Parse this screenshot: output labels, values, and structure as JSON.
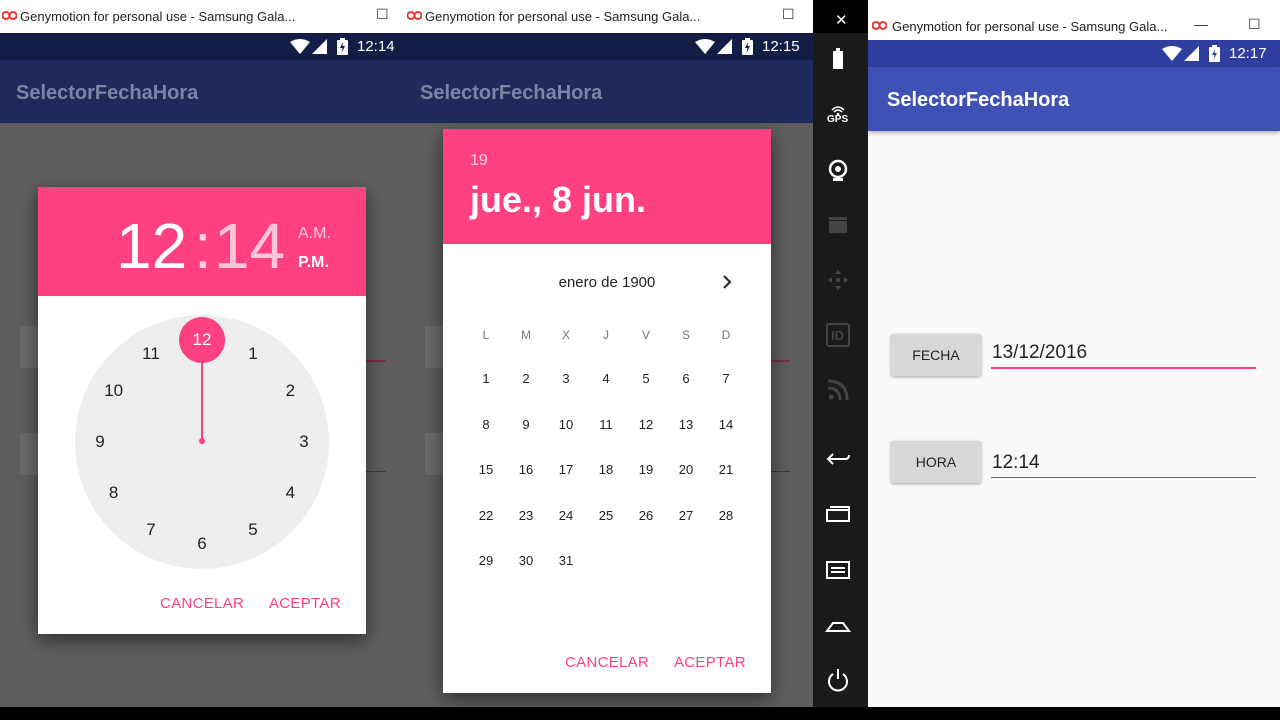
{
  "windows": [
    {
      "title": "Genymotion for personal use - Samsung Gala...",
      "time": "12:14",
      "app_title": "SelectorFechaHora"
    },
    {
      "title": "Genymotion for personal use - Samsung Gala...",
      "time": "12:15",
      "app_title": "SelectorFechaHora"
    },
    {
      "title": "Genymotion for personal use - Samsung Gala...",
      "time": "12:17",
      "app_title": "SelectorFechaHora"
    }
  ],
  "window_controls": {
    "minimize": "—",
    "maximize": "☐",
    "close": "✕"
  },
  "time_picker": {
    "hour": "12",
    "colon": ":",
    "minute": "14",
    "am": "A.M.",
    "pm": "P.M.",
    "clock_numbers": [
      "12",
      "1",
      "2",
      "3",
      "4",
      "5",
      "6",
      "7",
      "8",
      "9",
      "10",
      "11"
    ],
    "selected": "12",
    "cancel": "CANCELAR",
    "accept": "ACEPTAR"
  },
  "date_picker": {
    "year": "19",
    "date": "jue., 8 jun.",
    "month_label": "enero de 1900",
    "weekdays": [
      "L",
      "M",
      "X",
      "J",
      "V",
      "S",
      "D"
    ],
    "days": [
      "1",
      "2",
      "3",
      "4",
      "5",
      "6",
      "7",
      "8",
      "9",
      "10",
      "11",
      "12",
      "13",
      "14",
      "15",
      "16",
      "17",
      "18",
      "19",
      "20",
      "21",
      "22",
      "23",
      "24",
      "25",
      "26",
      "27",
      "28",
      "29",
      "30",
      "31"
    ],
    "cancel": "CANCELAR",
    "accept": "ACEPTAR"
  },
  "sidebar_icons": [
    "battery-icon",
    "gps-icon",
    "webcam-icon",
    "media-icon",
    "move-icon",
    "id-icon",
    "rss-icon",
    "back-icon",
    "recents-icon",
    "menu-icon",
    "home-icon",
    "power-icon"
  ],
  "sidebar_gps_label": "GPS",
  "sidebar_id_label": "ID",
  "form": {
    "fecha_button": "FECHA",
    "fecha_value": "13/12/2016",
    "hora_button": "HORA",
    "hora_value": "12:14"
  },
  "colors": {
    "accent": "#ff4081",
    "primary": "#3f51b5",
    "primary_dim": "#1f2a5c",
    "dark_sidebar": "#1a1a1a"
  }
}
